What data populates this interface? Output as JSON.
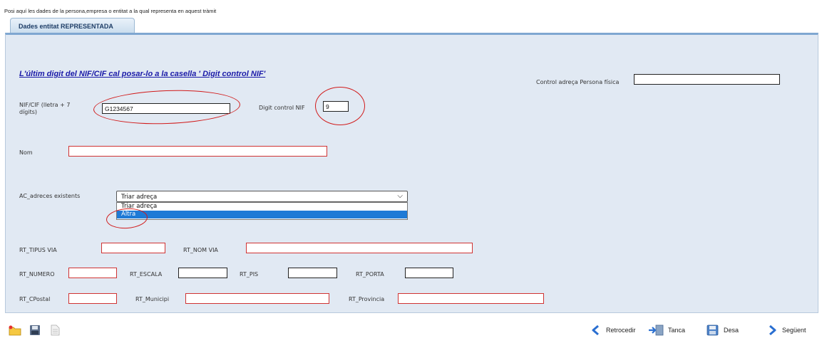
{
  "intro_text": "Posi aquí les dades de la persona,empresa o entitat a la qual representa en aquest tràmit",
  "tab_label": "Dades entitat REPRESENTADA",
  "info_link": "L'últim digit del NIF/CIF  cal posar-lo a la casella ' Digit control NIF'",
  "control_adreca": {
    "label": "Control adreça Persona física",
    "value": ""
  },
  "nif": {
    "label_line1": "NIF/CIF (lletra + 7",
    "label_line2": "dígits)",
    "value": "G1234567"
  },
  "digit_control": {
    "label": "Digit control NIF",
    "value": "9"
  },
  "nom": {
    "label": "Nom",
    "value": ""
  },
  "adreces": {
    "label": "AC_adreces existents",
    "selected": "Triar adreça",
    "options": [
      "Triar adreça",
      "Altra"
    ],
    "highlighted": "Altra"
  },
  "fields": {
    "tipus_via": "RT_TIPUS VIA",
    "nom_via": "RT_NOM VIA",
    "numero": "RT_NUMERO",
    "escala": "RT_ESCALA",
    "pis": "RT_PIS",
    "porta": "RT_PORTA",
    "cpostal": "RT_CPostal",
    "municipi": "RT_Municipi",
    "provincia": "RT_Provincia"
  },
  "footer": {
    "retrocedir": "Retrocedir",
    "tanca": "Tanca",
    "desa": "Desa",
    "seguent": "Següent"
  },
  "colors": {
    "panel": "#e1e9f3",
    "required_border": "#d03333",
    "annotation": "#d11b1b",
    "link": "#1a1aa8"
  }
}
